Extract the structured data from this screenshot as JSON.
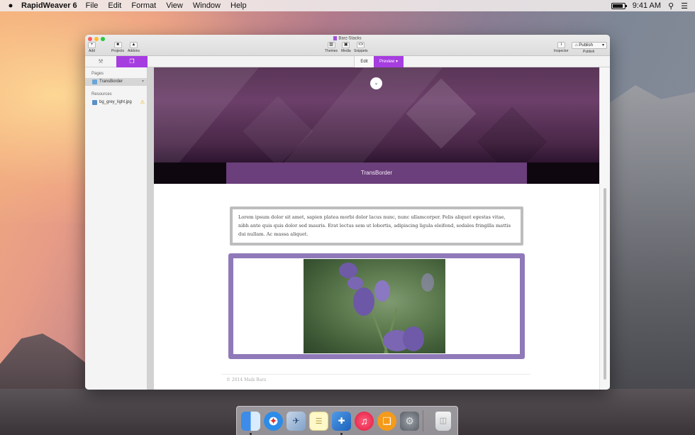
{
  "menubar": {
    "apple": "",
    "app_name": "RapidWeaver 6",
    "menus": [
      "File",
      "Edit",
      "Format",
      "View",
      "Window",
      "Help"
    ],
    "time": "9:41 AM",
    "search_icon": "search-icon",
    "list_icon": "notification-list-icon"
  },
  "window": {
    "title": "Barz-Stacks",
    "toolbar": {
      "add": "Add",
      "projects": "Projects",
      "addons": "Addons",
      "themes": "Themes",
      "media": "Media",
      "snippets": "Snippets",
      "inspector": "Inspector",
      "publish_button": "Publish",
      "publish_label": "Publish"
    },
    "segments": {
      "edit": "Edit",
      "preview": "Preview"
    }
  },
  "sidebar": {
    "pages_heading": "Pages",
    "pages": [
      {
        "label": "TransBorder"
      }
    ],
    "resources_heading": "Resources",
    "resources": [
      {
        "label": "bg_grey_light.jpg"
      }
    ]
  },
  "preview": {
    "hero_title": "TransBorder",
    "body_text": "Lorem ipsum dolor sit amet, sapien platea morbi dolor lacus nunc, nunc ullamcorper. Felis aliquet egestas vitae, nibh ante quis quis dolor sed mauris. Erat lectus sem ut lobortis, adipiscing ligula eleifend, sodales fringilla mattis dui nullam. Ac massa aliquet.",
    "footer": "© 2014 Maik Barz"
  },
  "colors": {
    "accent": "#a63de0",
    "hero_bar": "#6b3f7b",
    "image_frame": "#8f79b9"
  }
}
